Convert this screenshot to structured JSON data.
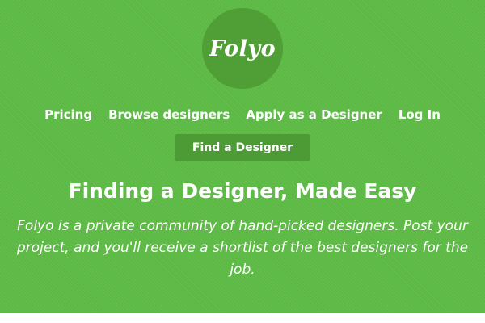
{
  "colors": {
    "background": "#5cb944",
    "logo_circle": "#4f9e36",
    "button": "#4d9b35",
    "text": "#ffffff"
  },
  "logo": {
    "text": "Folyo"
  },
  "nav": {
    "items": [
      {
        "label": "Pricing"
      },
      {
        "label": "Browse designers"
      },
      {
        "label": "Apply as a Designer"
      },
      {
        "label": "Log In"
      }
    ]
  },
  "cta": {
    "label": "Find a Designer"
  },
  "hero": {
    "headline": "Finding a Designer, Made Easy",
    "tagline": "Folyo is a private community of hand-picked designers. Post your project, and you'll receive a shortlist of the best designers for the job."
  }
}
